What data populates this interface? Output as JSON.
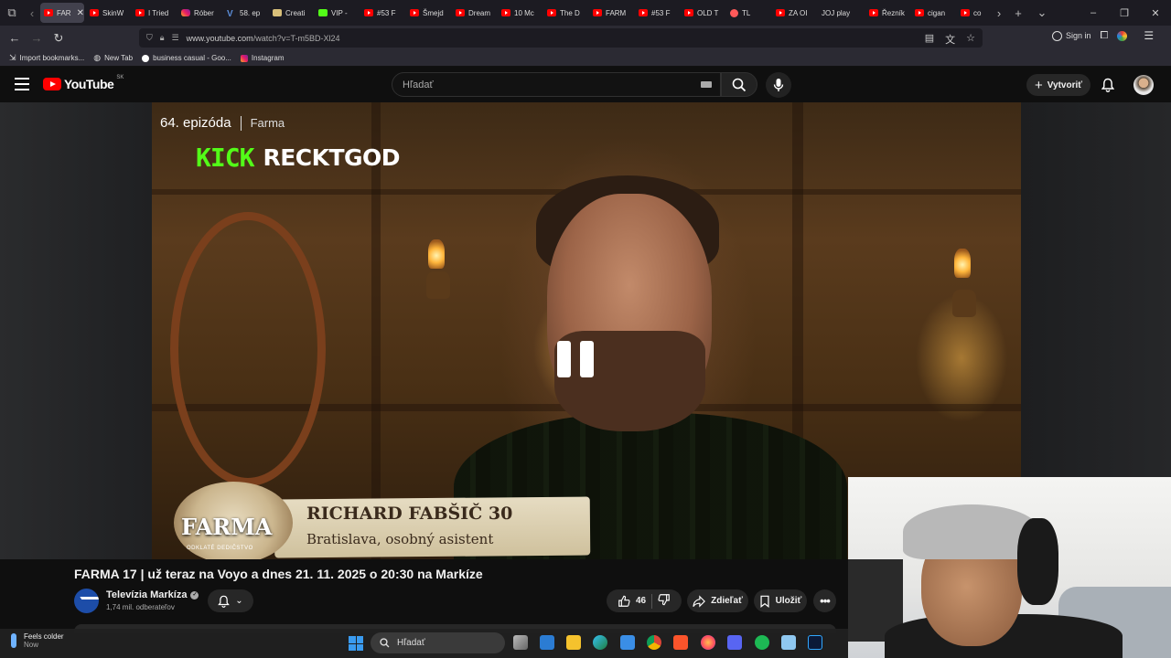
{
  "browser": {
    "tabs": [
      {
        "label": "FAR",
        "icon": "youtube",
        "active": true
      },
      {
        "label": "SkinW",
        "icon": "youtube"
      },
      {
        "label": "I Tried",
        "icon": "youtube"
      },
      {
        "label": "Róber",
        "icon": "instagram"
      },
      {
        "label": "58. ep",
        "icon": "voyo"
      },
      {
        "label": "Creati",
        "icon": "doc"
      },
      {
        "label": "VIP -",
        "icon": "kick"
      },
      {
        "label": "#53 F",
        "icon": "youtube"
      },
      {
        "label": "Šmejd",
        "icon": "youtube"
      },
      {
        "label": "Dream",
        "icon": "youtube"
      },
      {
        "label": "10 Mc",
        "icon": "youtube"
      },
      {
        "label": "The D",
        "icon": "youtube"
      },
      {
        "label": "FARM",
        "icon": "youtube"
      },
      {
        "label": "#53 F",
        "icon": "youtube"
      },
      {
        "label": "OLD T",
        "icon": "youtube"
      },
      {
        "label": "TL",
        "icon": "dot"
      },
      {
        "label": "ZA OI",
        "icon": "youtube"
      },
      {
        "label": "JOJ play",
        "icon": "none"
      },
      {
        "label": "Řezník",
        "icon": "youtube"
      },
      {
        "label": "cigan",
        "icon": "youtube"
      },
      {
        "label": "co",
        "icon": "youtube"
      }
    ],
    "url_prefix": "www.youtube.com",
    "url_path": "/watch?v=T-m5BD-Xl24",
    "sign_in_label": "Sign in",
    "bookmarks": [
      "Import bookmarks...",
      "New Tab",
      "business casual - Goo...",
      "Instagram"
    ]
  },
  "youtube": {
    "logo_text": "YouTube",
    "country_code": "SK",
    "search_placeholder": "Hľadať",
    "create_label": "Vytvoriť"
  },
  "player": {
    "episode": "64. epizóda",
    "series": "Farma",
    "kick_logo": "KICK",
    "kick_channel": "RECKTGOD",
    "lower_third_show": "FARMA",
    "lower_third_tag": "ODKLATÉ DEDIČSTVO",
    "contestant_name": "RICHARD FABŠIČ 30",
    "contestant_info": "Bratislava, osobný asistent"
  },
  "video": {
    "title": "FARMA 17 | už teraz na Voyo a dnes 21. 11. 2025 o 20:30 na Markíze",
    "channel_name": "Televízia Markíza",
    "subscribers": "1,74 mil. odberateľov",
    "like_count": "46",
    "share_label": "Zdieľať",
    "save_label": "Uložiť"
  },
  "taskbar": {
    "weather_title": "Feels colder",
    "weather_sub": "Now",
    "search_placeholder": "Hľadať"
  },
  "colors": {
    "youtube_red": "#ff0000",
    "kick_green": "#53fc18",
    "background": "#0f0f0f"
  }
}
